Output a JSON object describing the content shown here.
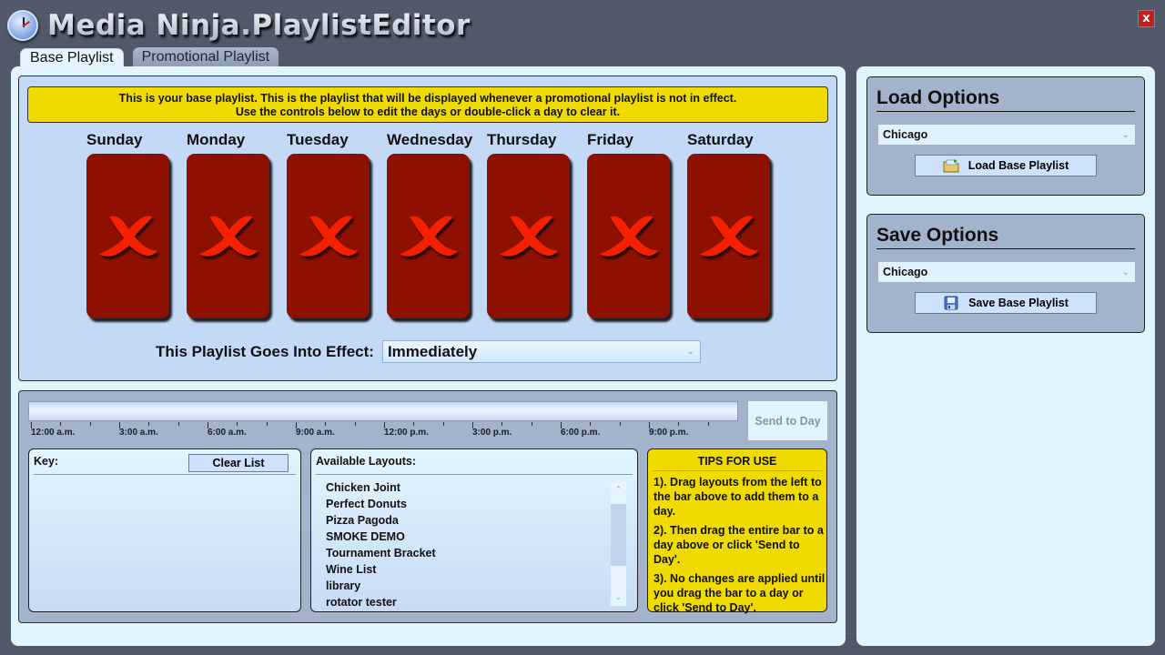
{
  "window": {
    "title": "Media Ninja.PlaylistEditor",
    "close_label": "x"
  },
  "tabs": [
    {
      "label": "Base Playlist",
      "active": true
    },
    {
      "label": "Promotional Playlist",
      "active": false
    }
  ],
  "banner": {
    "line1": "This is your base playlist. This is the playlist that will be displayed whenever a promotional playlist is not in effect.",
    "line2": "Use the controls below to edit the days or double-click a day to clear it."
  },
  "days": [
    {
      "label": "Sunday",
      "status": "empty"
    },
    {
      "label": "Monday",
      "status": "empty"
    },
    {
      "label": "Tuesday",
      "status": "empty"
    },
    {
      "label": "Wednesday",
      "status": "empty"
    },
    {
      "label": "Thursday",
      "status": "empty"
    },
    {
      "label": "Friday",
      "status": "empty"
    },
    {
      "label": "Saturday",
      "status": "empty"
    }
  ],
  "effect": {
    "label": "This Playlist Goes Into Effect:",
    "selected": "Immediately"
  },
  "timeline": {
    "labels": [
      "12:00 a.m.",
      "3:00 a.m.",
      "6:00 a.m.",
      "9:00 a.m.",
      "12:00 p.m.",
      "3:00 p.m.",
      "6:00 p.m.",
      "9:00 p.m."
    ],
    "send_label": "Send to Day"
  },
  "key_box": {
    "header": "Key:",
    "clear_label": "Clear List"
  },
  "layouts": {
    "header": "Available Layouts:",
    "items": [
      "Chicken Joint",
      "Perfect Donuts",
      "Pizza Pagoda",
      "SMOKE DEMO",
      "Tournament Bracket",
      "Wine List",
      "library",
      "rotator tester"
    ],
    "scroll_up": "^",
    "scroll_down": "v"
  },
  "tips": {
    "title": "TIPS FOR USE",
    "items": [
      "1). Drag layouts from the left to the bar above to add them to a day.",
      "2). Then drag the entire bar to a day above or click 'Send to Day'.",
      "3). No changes are applied until you drag the bar to a day or click 'Send to Day'."
    ]
  },
  "load_options": {
    "title": "Load Options",
    "selected": "Chicago",
    "button_label": "Load Base Playlist",
    "icon": "folder-icon"
  },
  "save_options": {
    "title": "Save Options",
    "selected": "Chicago",
    "button_label": "Save Base Playlist",
    "icon": "floppy-disk-icon"
  },
  "colors": {
    "banner": "#f0db00",
    "day_card": "#8d1001",
    "x_mark": "#f52000",
    "close_button": "#c0201c"
  }
}
